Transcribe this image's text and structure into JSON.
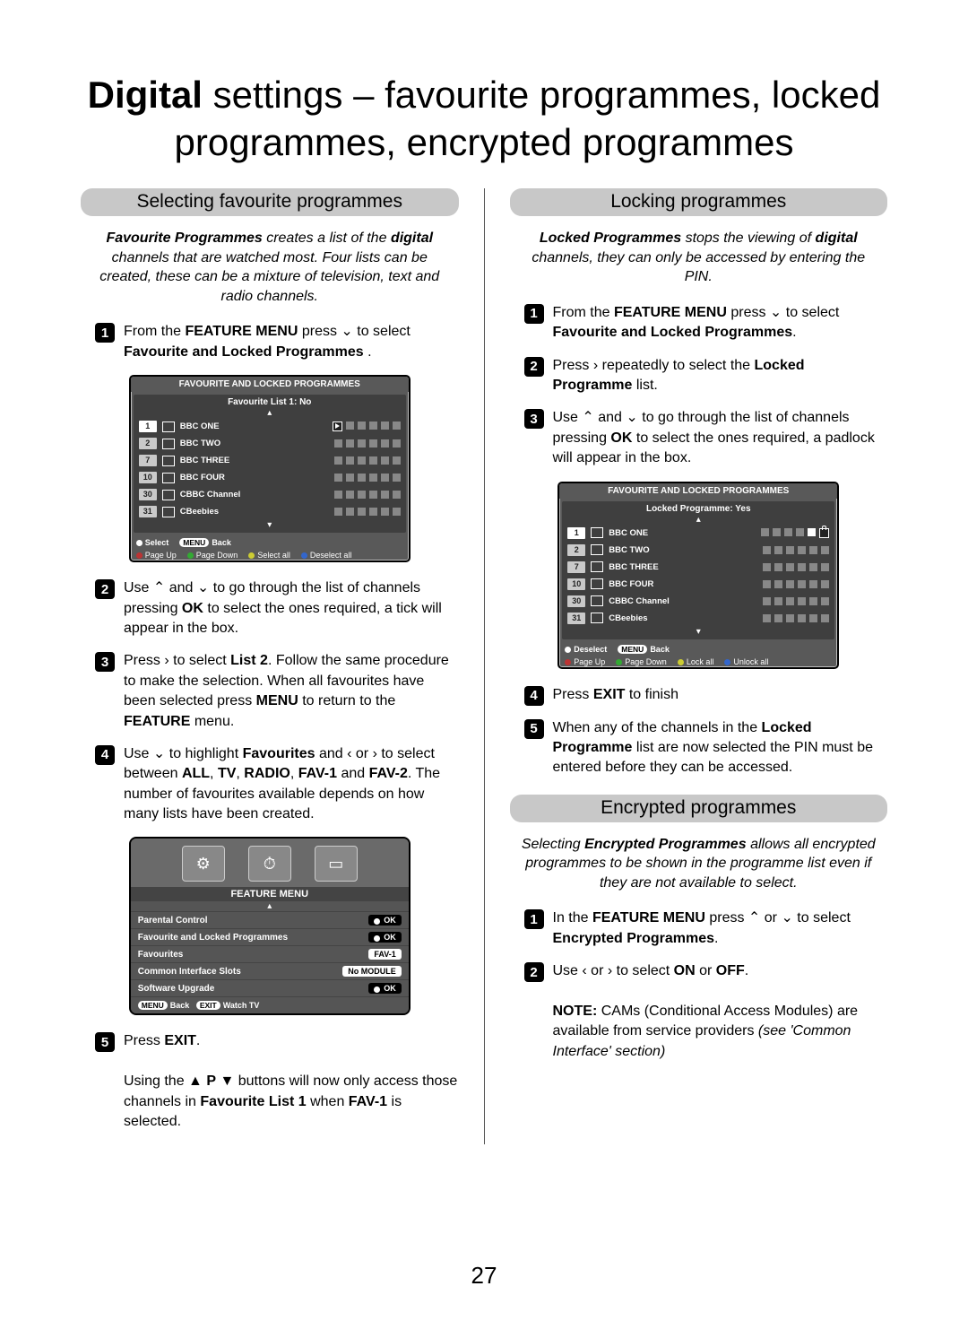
{
  "title_prefix": "Digital",
  "title_rest": " settings – favourite programmes, locked programmes, encrypted programmes",
  "page_number": "27",
  "left": {
    "header": "Selecting favourite programmes",
    "intro_html": "<span class='bi'>Favourite Programmes</span> <span style='font-style:italic'>creates a list of the</span> <span class='bi'>digital</span> <span style='font-style:italic'>channels that are watched most. Four lists can be created, these can be a mixture of television, text and radio channels.</span>",
    "steps": [
      "From the <b>FEATURE MENU</b> press <span class='arrow-icon'>⌄</span> to select <b>Favourite and Locked Programmes</b> .",
      "Use <span class='arrow-icon'>⌃</span> and <span class='arrow-icon'>⌄</span> to go through the list of channels pressing <b>OK</b> to select the ones required, a tick will appear in the box.",
      "Press <span class='arrow-icon'>›</span> to select <b>List 2</b>. Follow the same procedure to make the selection. When all favourites have been selected press <b>MENU</b> to return to the <b>FEATURE</b> menu.",
      "Use <span class='arrow-icon'>⌄</span> to highlight <b>Favourites</b> and <span class='arrow-icon'>‹</span> or <span class='arrow-icon'>›</span> to select between <b>ALL</b>, <b>TV</b>, <b>RADIO</b>, <b>FAV-1</b> and <b>FAV-2</b>. The number of favourites available depends on how many lists have been created.",
      "Press <b>EXIT</b>.<br><br>Using the ▲ <b>P</b> ▼ buttons will now only access those channels in <b>Favourite List 1</b> when <b>FAV-1</b> is selected."
    ],
    "osd_fav": {
      "title": "FAVOURITE AND LOCKED PROGRAMMES",
      "subtitle": "Favourite List 1: No",
      "rows": [
        {
          "n": "1",
          "name": "BBC ONE",
          "hl": true,
          "first_play": true
        },
        {
          "n": "2",
          "name": "BBC TWO"
        },
        {
          "n": "7",
          "name": "BBC THREE"
        },
        {
          "n": "10",
          "name": "BBC FOUR"
        },
        {
          "n": "30",
          "name": "CBBC Channel"
        },
        {
          "n": "31",
          "name": "CBeebies"
        }
      ],
      "legend": {
        "select": "Select",
        "back": "Back",
        "pgup": "Page Up",
        "pgdn": "Page Down",
        "selall": "Select all",
        "desall": "Deselect all"
      }
    },
    "feature_menu": {
      "title": "FEATURE MENU",
      "rows": [
        {
          "label": "Parental Control",
          "val": "OK",
          "dot": true
        },
        {
          "label": "Favourite and Locked Programmes",
          "val": "OK",
          "dot": true
        },
        {
          "label": "Favourites",
          "val": "FAV-1",
          "white": true
        },
        {
          "label": "Common Interface Slots",
          "val": "No MODULE",
          "white": true
        },
        {
          "label": "Software Upgrade",
          "val": "OK",
          "dot": true
        }
      ],
      "legend": {
        "back": "Back",
        "watch": "Watch TV"
      }
    }
  },
  "right": {
    "lock_header": "Locking programmes",
    "lock_intro": "<span class='bi'>Locked Programmes</span> <span style='font-style:italic'>stops the viewing of</span> <span class='bi'>digital</span> <span style='font-style:italic'>channels, they can only be accessed by entering the PIN.</span>",
    "lock_steps": [
      "From the <b>FEATURE MENU</b> press <span class='arrow-icon'>⌄</span> to select <b>Favourite and Locked Programmes</b>.",
      "Press <span class='arrow-icon'>›</span> repeatedly to select the <b>Locked Programme</b> list.",
      "Use <span class='arrow-icon'>⌃</span> and <span class='arrow-icon'>⌄</span> to go through the list of channels pressing <b>OK</b> to select the ones required, a padlock will appear in the box.",
      "Press <b>EXIT</b> to finish",
      "When any of the channels in the <b>Locked Programme</b> list are now selected the PIN must be entered before they can be accessed."
    ],
    "osd_lock": {
      "title": "FAVOURITE AND LOCKED PROGRAMMES",
      "subtitle": "Locked Programme: Yes",
      "rows": [
        {
          "n": "1",
          "name": "BBC ONE",
          "hl": true,
          "last_lock": true
        },
        {
          "n": "2",
          "name": "BBC TWO"
        },
        {
          "n": "7",
          "name": "BBC THREE"
        },
        {
          "n": "10",
          "name": "BBC FOUR"
        },
        {
          "n": "30",
          "name": "CBBC Channel"
        },
        {
          "n": "31",
          "name": "CBeebies"
        }
      ],
      "legend": {
        "deselect": "Deselect",
        "back": "Back",
        "pgup": "Page Up",
        "pgdn": "Page Down",
        "lockall": "Lock all",
        "unlockall": "Unlock all"
      }
    },
    "enc_header": "Encrypted programmes",
    "enc_intro": "<span style='font-style:italic'>Selecting</span> <span class='bi'>Encrypted Programmes</span> <span style='font-style:italic'>allows all encrypted programmes to be shown in the programme list even if they are not available to select.</span>",
    "enc_steps": [
      "In the <b>FEATURE MENU</b> press <span class='arrow-icon'>⌃</span> or <span class='arrow-icon'>⌄</span> to select <b>Encrypted Programmes</b>.",
      "Use <span class='arrow-icon'>‹</span> or <span class='arrow-icon'>›</span> to select <b>ON</b> or <b>OFF</b>.<br><br><span class='note'><b>NOTE:</b> CAMs (Conditional Access Modules) are available from service providers <i>(see 'Common Interface' section)</i></span>"
    ]
  }
}
